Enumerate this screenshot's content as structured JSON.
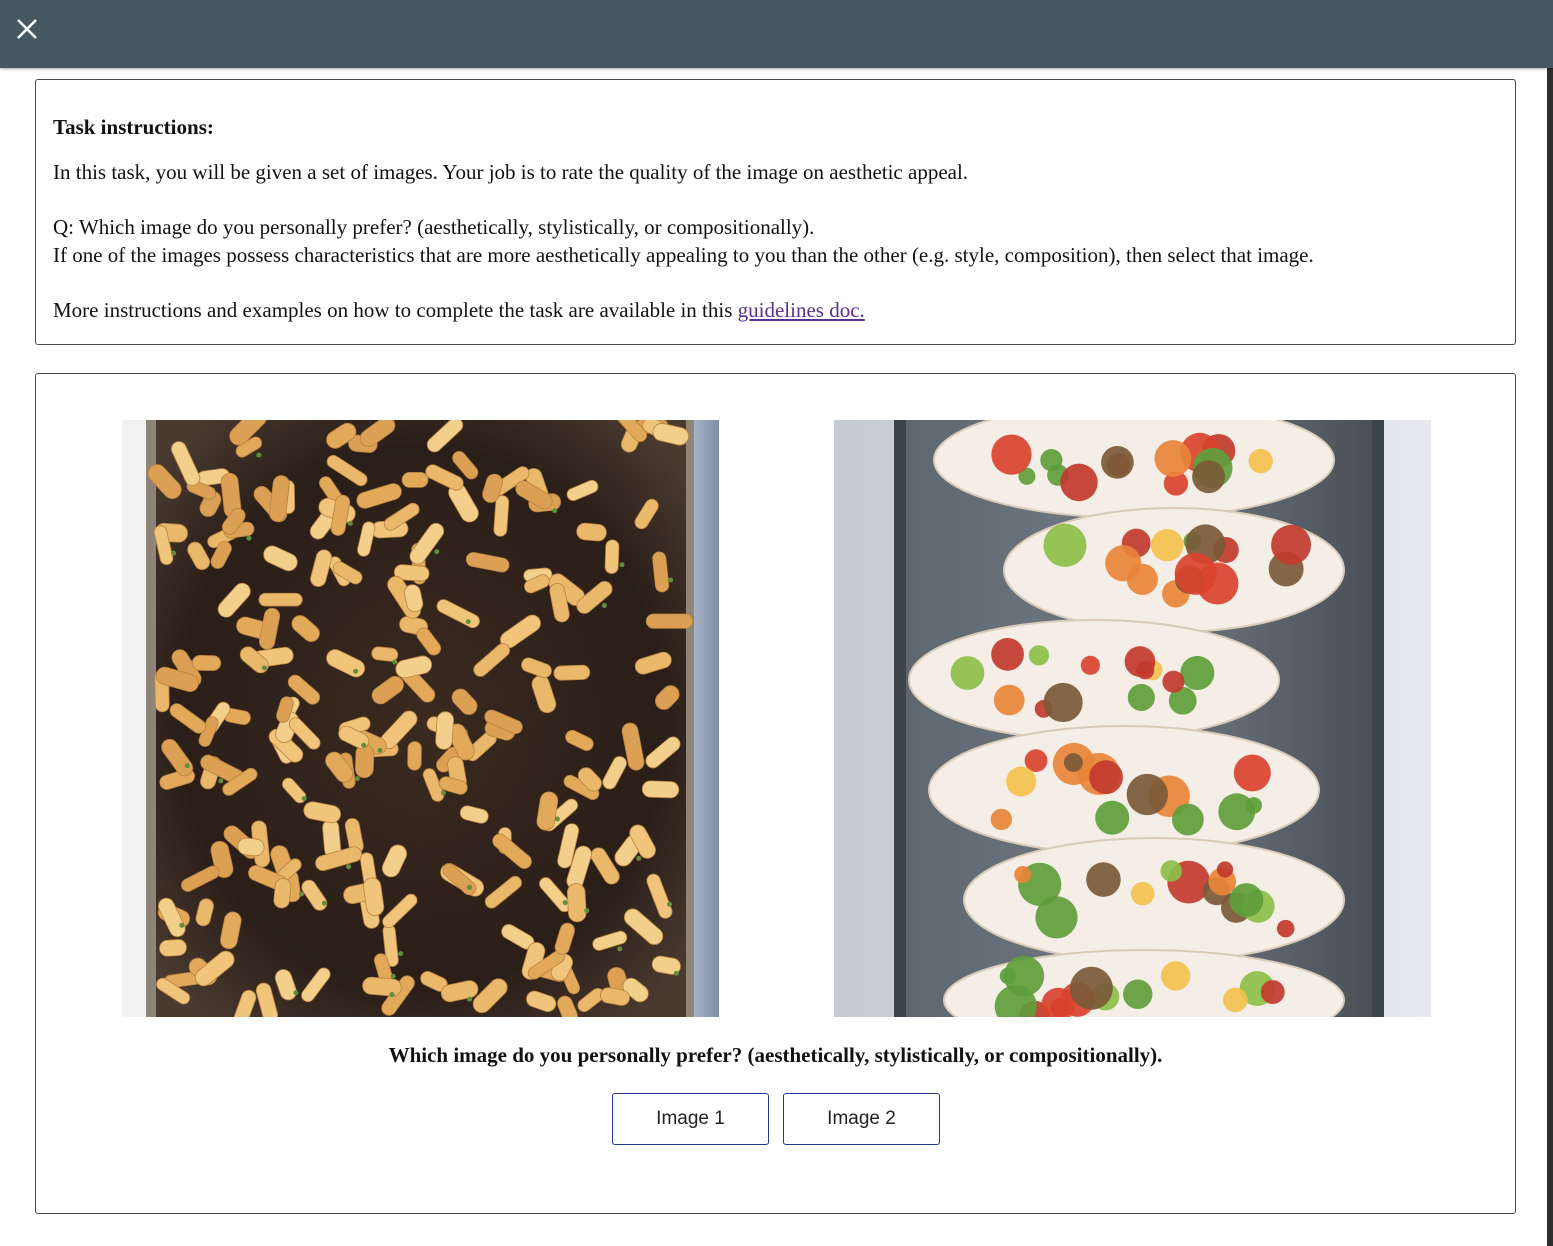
{
  "header": {
    "close_icon": "close-icon"
  },
  "instructions": {
    "title": "Task instructions:",
    "intro": "In this task, you will be given a set of images. Your job is to rate the quality of the image on aesthetic appeal.",
    "question_line": "Q: Which image do you personally prefer? (aesthetically, stylistically, or compositionally).",
    "criteria_line": "If one of the images possess characteristics that are more aesthetically appealing to you than the other (e.g. style, composition), then select that image.",
    "more_prefix": "More instructions and examples on how to complete the task are available in this ",
    "link_text": "guidelines doc."
  },
  "task": {
    "question": "Which image do you personally prefer? (aesthetically, stylistically, or compositionally).",
    "image1_alt": "baked-pasta-tray-photo",
    "image2_alt": "tacos-tray-photo",
    "button1_label": "Image 1",
    "button2_label": "Image 2"
  },
  "colors": {
    "topbar": "#455862",
    "link": "#5a2d91",
    "button_border": "#1f3a8a"
  }
}
